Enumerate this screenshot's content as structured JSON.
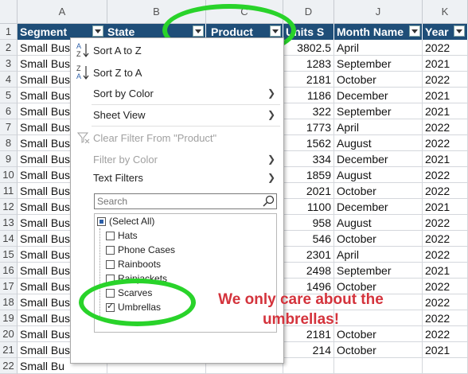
{
  "columns": [
    "A",
    "B",
    "C",
    "D",
    "J",
    "K"
  ],
  "row_numbers": [
    "1",
    "2",
    "3",
    "4",
    "5",
    "6",
    "7",
    "8",
    "9",
    "10",
    "11",
    "12",
    "13",
    "14",
    "15",
    "16",
    "17",
    "18",
    "19",
    "20",
    "21",
    "22"
  ],
  "headers": {
    "segment": "Segment",
    "state": "State",
    "product": "Product",
    "units": "Units S",
    "month": "Month Name",
    "year": "Year"
  },
  "segment_values": [
    "Small Bus",
    "Small Bus",
    "Small Bus",
    "Small Bus",
    "Small Bus",
    "Small Bus",
    "Small Bus",
    "Small Bus",
    "Small Bus",
    "Small Bus",
    "Small Bus",
    "Small Bus",
    "Small Bus",
    "Small Bus",
    "Small Bus",
    "Small Bus",
    "Small Bus",
    "Small Bus",
    "Small Bus",
    "Small Bus",
    "Small Bu"
  ],
  "rows": [
    {
      "units": "3802.5",
      "month": "April",
      "year": "2022"
    },
    {
      "units": "1283",
      "month": "September",
      "year": "2021"
    },
    {
      "units": "2181",
      "month": "October",
      "year": "2022"
    },
    {
      "units": "1186",
      "month": "December",
      "year": "2021"
    },
    {
      "units": "322",
      "month": "September",
      "year": "2021"
    },
    {
      "units": "1773",
      "month": "April",
      "year": "2022"
    },
    {
      "units": "1562",
      "month": "August",
      "year": "2022"
    },
    {
      "units": "334",
      "month": "December",
      "year": "2021"
    },
    {
      "units": "1859",
      "month": "August",
      "year": "2022"
    },
    {
      "units": "2021",
      "month": "October",
      "year": "2022"
    },
    {
      "units": "1100",
      "month": "December",
      "year": "2021"
    },
    {
      "units": "958",
      "month": "August",
      "year": "2022"
    },
    {
      "units": "546",
      "month": "October",
      "year": "2022"
    },
    {
      "units": "2301",
      "month": "April",
      "year": "2022"
    },
    {
      "units": "2498",
      "month": "September",
      "year": "2021"
    },
    {
      "units": "1496",
      "month": "October",
      "year": "2022"
    },
    {
      "units": "",
      "month": "",
      "year": "2022"
    },
    {
      "units": "",
      "month": "",
      "year": "2022"
    },
    {
      "units": "2181",
      "month": "October",
      "year": "2022"
    },
    {
      "units": "214",
      "month": "October",
      "year": "2021"
    },
    {
      "units": "",
      "month": "",
      "year": ""
    }
  ],
  "menu": {
    "sort_az": "Sort A to Z",
    "sort_za": "Sort Z to A",
    "sort_by_color": "Sort by Color",
    "sheet_view": "Sheet View",
    "clear_filter": "Clear Filter From \"Product\"",
    "filter_by_color": "Filter by Color",
    "text_filters": "Text Filters",
    "search_placeholder": "Search",
    "items": [
      "(Select All)",
      "Hats",
      "Phone Cases",
      "Rainboots",
      "Rainjackets",
      "Scarves",
      "Umbrellas"
    ]
  },
  "annotation": {
    "line1": "We only care about the",
    "line2": "umbrellas!"
  },
  "colors": {
    "header_bg": "#1f4e78",
    "highlight_ring": "#29d32a",
    "annotation_text": "#d4333c"
  }
}
